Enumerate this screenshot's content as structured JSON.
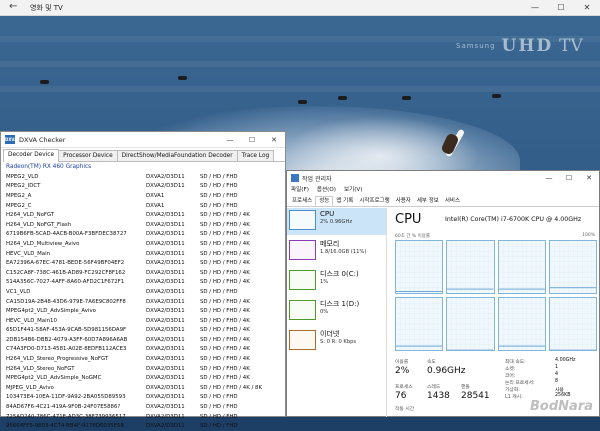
{
  "movies_tv": {
    "title": "영화 및 TV",
    "back_glyph": "←",
    "controls": [
      "—",
      "☐",
      "✕"
    ],
    "logo": {
      "brand": "Samsung",
      "mark": "UHD",
      "suffix": "TV"
    }
  },
  "dxva": {
    "title": "DXVA Checker",
    "icon_text": "DXVA",
    "controls": [
      "—",
      "☐",
      "✕"
    ],
    "tabs": [
      "Decoder Device",
      "Processor Device",
      "DirectShow/MediaFoundation Decoder",
      "Trace Log"
    ],
    "adapter": "Radeon(TM) RX 460 Graphics",
    "rows": [
      [
        "MPEG2_VLD",
        "DXVA2/D3D11",
        "SD / HD / FHD"
      ],
      [
        "MPEG2_IDCT",
        "DXVA2/D3D11",
        "SD / HD / FHD"
      ],
      [
        "MPEG2_A",
        "DXVA1",
        "SD / HD / FHD"
      ],
      [
        "MPEG2_C",
        "DXVA1",
        "SD / HD / FHD"
      ],
      [
        "H264_VLD_NoFGT",
        "DXVA2/D3D11",
        "SD / HD / FHD / 4K"
      ],
      [
        "H264_VLD_NoFGT_Flash",
        "DXVA2/D3D11",
        "SD / HD / FHD / 4K"
      ],
      [
        "6719B6FB-5CAD-4ACB-B00A-F3BFDEC38727",
        "DXVA2/D3D11",
        "SD / HD / FHD / 4K"
      ],
      [
        "H264_VLD_Multiview_Avivo",
        "DXVA2/D3D11",
        "SD / HD / FHD / 4K"
      ],
      [
        "HEVC_VLD_Main",
        "DXVA2/D3D11",
        "SD / HD / FHD / 4K"
      ],
      [
        "EA72396A-67EC-4781-BEDE-56F49BF04EF2",
        "DXVA2/D3D11",
        "SD / HD / FHD / 4K"
      ],
      [
        "C152CA8F-738C-461B-AD89-FC292CF8F162",
        "DXVA2/D3D11",
        "SD / HD / FHD / 4K"
      ],
      [
        "514A356C-7027-4AFF-8A60-AFD2C1F672F1",
        "DXVA2/D3D11",
        "SD / HD / FHD / 4K"
      ],
      [
        "VC1_VLD",
        "DXVA2/D3D11",
        "SD / HD / FHD"
      ],
      [
        "CA15D19A-2B48-43D6-979E-7A6E9C802FF8",
        "DXVA2/D3D11",
        "SD / HD / FHD / 4K"
      ],
      [
        "MPEG4pt2_VLD_AdvSimple_Avivo",
        "DXVA2/D3D11",
        "SD / HD / FHD / 4K"
      ],
      [
        "HEVC_VLD_Main10",
        "DXVA2/D3D11",
        "SD / HD / FHD / 4K"
      ],
      [
        "65D1F441-58AF-453A-9CAB-5D981156DA9F",
        "DXVA2/D3D11",
        "SD / HD / FHD / 4K"
      ],
      [
        "2DB154B6-DBB2-4079-A3FF-60D7A896A6AB",
        "DXVA2/D3D11",
        "SD / HD / FHD / 4K"
      ],
      [
        "C74A3FD0-D713-4581-A02E-8EDFB112ACE3",
        "DXVA2/D3D11",
        "SD / HD / FHD / 4K"
      ],
      [
        "H264_VLD_Stereo_Progressive_NoFGT",
        "DXVA2/D3D11",
        "SD / HD / FHD / 4K"
      ],
      [
        "H264_VLD_Stereo_NoFGT",
        "DXVA2/D3D11",
        "SD / HD / FHD / 4K"
      ],
      [
        "MPEG4pt2_VLD_AdvSimple_NoGMC",
        "DXVA2/D3D11",
        "SD / HD / FHD / 4K"
      ],
      [
        "MJPEG_VLD_Avivo",
        "DXVA2/D3D11",
        "SD / HD / FHD / 4K / 8K"
      ],
      [
        "103473E4-10EA-11DF-9A92-2BA055D89593",
        "DXVA2/D3D11",
        "SD / HD / FHD"
      ],
      [
        "84AD67F6-4C21-419A-9F0B-24F07E5886?",
        "DXVA2/D3D11",
        "SD / HD / FHD"
      ],
      [
        "725AD240-786C-471E-AD3C-38F739936517",
        "DXVA2/D3D11",
        "SD / HD / FHD"
      ],
      [
        "95664FF5-9E03-4C74-BB4F-9178D6035E58",
        "DXVA2/D3D11",
        "SD / HD / FHD"
      ]
    ]
  },
  "taskmgr": {
    "title": "작업 관리자",
    "controls": [
      "—",
      "☐",
      "✕"
    ],
    "menu": [
      "파일(F)",
      "옵션(O)",
      "보기(V)"
    ],
    "tabs": [
      "프로세스",
      "성능",
      "앱 기록",
      "시작프로그램",
      "사용자",
      "세부 정보",
      "서비스"
    ],
    "resources": [
      {
        "name": "CPU",
        "value": "2% 0.96GHz",
        "kind": "cpu"
      },
      {
        "name": "메모리",
        "value": "1.8/16.0GB (11%)",
        "kind": "mem"
      },
      {
        "name": "디스크 0(C:)",
        "value": "1%",
        "kind": "disk"
      },
      {
        "name": "디스크 1(D:)",
        "value": "0%",
        "kind": "disk"
      },
      {
        "name": "이더넷",
        "value": "S: 0 R: 0 Kbps",
        "kind": "eth"
      }
    ],
    "cpu": {
      "heading": "CPU",
      "model": "Intel(R) Core(TM) i7-6700K CPU @ 4.00GHz",
      "axis_top_left": "60초 간 % 이용률",
      "axis_top_right": "100%",
      "stats": {
        "util_label": "이용률",
        "util_value": "2%",
        "speed_label": "속도",
        "speed_value": "0.96GHz",
        "proc_label": "프로세스",
        "proc_value": "76",
        "thread_label": "스레드",
        "thread_value": "1438",
        "handle_label": "핸들",
        "handle_value": "28541",
        "uptime_label": "작동 시간"
      },
      "kv": [
        {
          "k": "최대 속도:",
          "v": "4.00GHz"
        },
        {
          "k": "소켓:",
          "v": "1"
        },
        {
          "k": "코어:",
          "v": "4"
        },
        {
          "k": "논리 프로세서:",
          "v": "8"
        },
        {
          "k": "가상화:",
          "v": "사용"
        },
        {
          "k": "L1 캐시:",
          "v": "256KB"
        }
      ],
      "core_usage": [
        3,
        2,
        4,
        2,
        3,
        2,
        2,
        1
      ]
    }
  },
  "watermark": "BodNara"
}
